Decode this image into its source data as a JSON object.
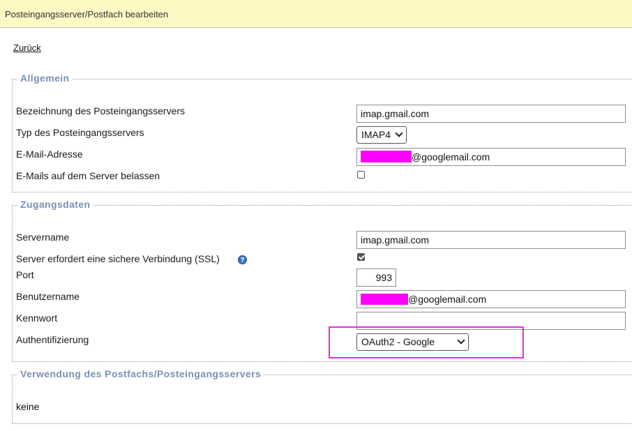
{
  "header": {
    "title": "Posteingangsserver/Postfach bearbeiten"
  },
  "nav": {
    "back_label": "Zurück"
  },
  "sections": {
    "allgemein": {
      "legend": "Allgemein",
      "server_name_label": "Bezeichnung des Posteingangsservers",
      "server_name_value": "imap.gmail.com",
      "server_type_label": "Typ des Posteingangsservers",
      "server_type_value": "IMAP4",
      "email_label": "E-Mail-Adresse",
      "email_value_suffix": "@googlemail.com",
      "keep_mails_label": "E-Mails auf dem Server belassen",
      "keep_mails_checked": false
    },
    "zugangsdaten": {
      "legend": "Zugangsdaten",
      "servername_label": "Servername",
      "servername_value": "imap.gmail.com",
      "ssl_label": "Server erfordert eine sichere Verbindung (SSL)",
      "ssl_checked": true,
      "help_glyph": "?",
      "port_label": "Port",
      "port_value": "993",
      "username_label": "Benutzername",
      "username_value_suffix": "@googlemail.com",
      "password_label": "Kennwort",
      "password_value": "",
      "auth_label": "Authentifizierung",
      "auth_value": "OAuth2 - Google"
    },
    "verwendung": {
      "legend": "Verwendung des Postfachs/Posteingangsservers",
      "value": "keine"
    }
  },
  "colors": {
    "header_bg": "#fdf8c4",
    "legend_color": "#7990b6",
    "redaction": "#ff00ff",
    "highlight_border": "#e32ee3"
  },
  "icons": {
    "help": "help-icon",
    "dropdown": "chevron-down-icon",
    "checkbox_checked": "checkmark-icon"
  }
}
